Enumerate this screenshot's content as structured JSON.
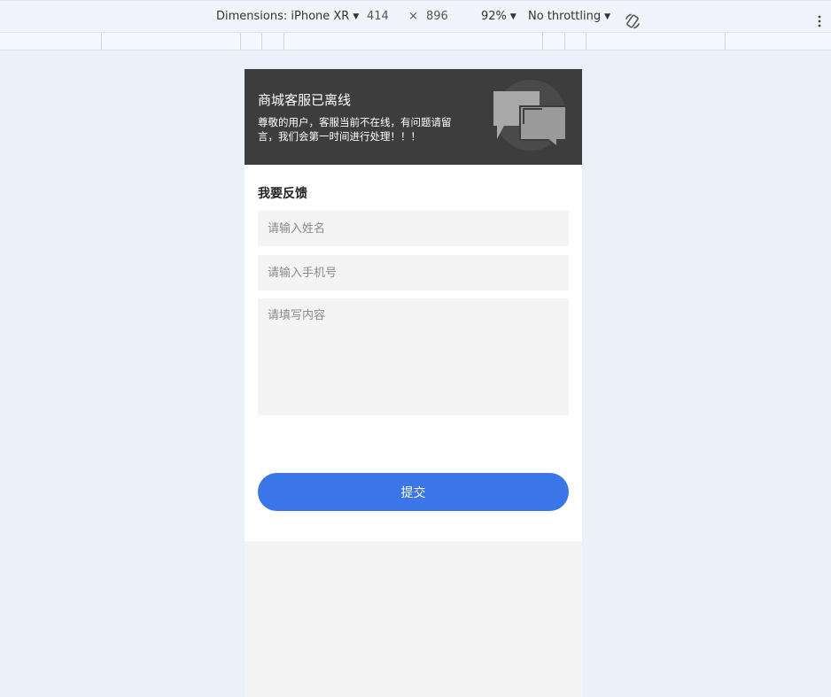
{
  "devtools": {
    "dimensions_label": "Dimensions: iPhone XR",
    "width": "414",
    "times": "×",
    "height": "896",
    "zoom": "92%",
    "throttling": "No throttling"
  },
  "banner": {
    "title": "商城客服已离线",
    "description": "尊敬的用户，客服当前不在线，有问题请留言，我们会第一时间进行处理！！！",
    "icon": "chat-bubbles-icon"
  },
  "feedback": {
    "heading": "我要反馈",
    "name_placeholder": "请输入姓名",
    "phone_placeholder": "请输入手机号",
    "content_placeholder": "请填写内容",
    "submit_label": "提交"
  },
  "colors": {
    "accent": "#3a76e8",
    "banner_bg": "#3d3d3d",
    "page_bg": "#ebf1fb",
    "field_bg": "#f4f4f4"
  }
}
